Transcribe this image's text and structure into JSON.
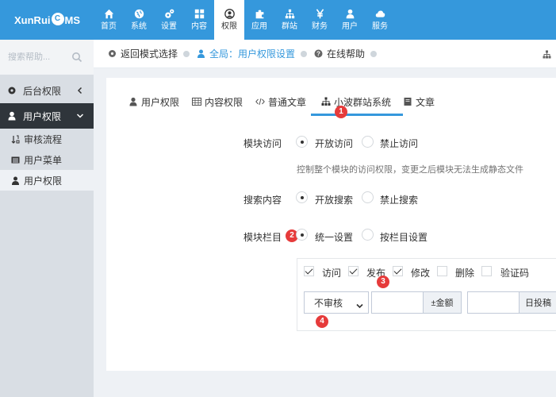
{
  "app": {
    "logo_left": "XunRui",
    "logo_mark": "C",
    "logo_right": "MS"
  },
  "nav": [
    {
      "label": "首页",
      "icon": "home-icon"
    },
    {
      "label": "系统",
      "icon": "globe-icon"
    },
    {
      "label": "设置",
      "icon": "gears-icon"
    },
    {
      "label": "内容",
      "icon": "grid-icon"
    },
    {
      "label": "权限",
      "icon": "user-circle-icon",
      "active": true
    },
    {
      "label": "应用",
      "icon": "puzzle-icon"
    },
    {
      "label": "群站",
      "icon": "sitemap-icon"
    },
    {
      "label": "财务",
      "icon": "yen-icon"
    },
    {
      "label": "用户",
      "icon": "user-icon"
    },
    {
      "label": "服务",
      "icon": "cloud-icon"
    }
  ],
  "sidebar": {
    "search_placeholder": "搜索帮助...",
    "groups": [
      {
        "label": "后台权限",
        "icon": "gears-icon"
      },
      {
        "label": "用户权限",
        "icon": "user-icon"
      }
    ],
    "items": [
      {
        "label": "审核流程",
        "icon": "sort-icon"
      },
      {
        "label": "用户菜单",
        "icon": "list-icon"
      },
      {
        "label": "用户权限",
        "icon": "user-icon"
      }
    ]
  },
  "breadcrumb": {
    "back": "返回模式选择",
    "scope": "全局：用户权限设置",
    "help": "在线帮助"
  },
  "tabs": [
    {
      "label": "用户权限",
      "icon": "user-icon"
    },
    {
      "label": "内容权限",
      "icon": "table-icon"
    },
    {
      "label": "普通文章",
      "icon": "code-icon"
    },
    {
      "label": "小波群站系统",
      "icon": "sitemap-icon",
      "active": true
    },
    {
      "label": "文章",
      "icon": "book-icon"
    }
  ],
  "form": {
    "module_access": {
      "label": "模块访问",
      "options": [
        "开放访问",
        "禁止访问"
      ],
      "selected": 0,
      "help": "控制整个模块的访问权限，变更之后模块无法生成静态文件"
    },
    "search_content": {
      "label": "搜索内容",
      "options": [
        "开放搜索",
        "禁止搜索"
      ],
      "selected": 0
    },
    "module_column": {
      "label": "模块栏目",
      "options": [
        "统一设置",
        "按栏目设置"
      ],
      "selected": 0
    },
    "permissions": [
      {
        "label": "访问",
        "checked": true
      },
      {
        "label": "发布",
        "checked": true
      },
      {
        "label": "修改",
        "checked": true
      },
      {
        "label": "删除",
        "checked": false
      },
      {
        "label": "验证码",
        "checked": false
      }
    ],
    "review_select": "不审核",
    "amount_addon": "±金额",
    "daily_addon": "日投稿"
  },
  "badges": [
    "1",
    "2",
    "3",
    "4"
  ],
  "colors": {
    "topbar": "#3598dc",
    "active_sidebar": "#2f353b",
    "badge": "#e63b3b"
  }
}
